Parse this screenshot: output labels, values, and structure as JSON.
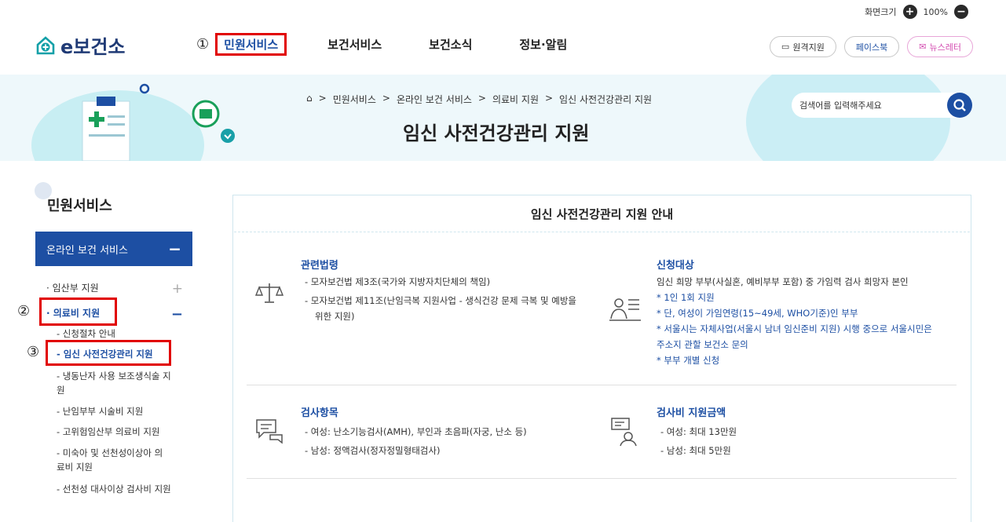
{
  "zoom": {
    "label": "화면크기",
    "value": "100%"
  },
  "logo": {
    "text": "e보건소"
  },
  "gnb": {
    "marker": "①",
    "items": [
      {
        "label": "민원서비스"
      },
      {
        "label": "보건서비스"
      },
      {
        "label": "보건소식"
      },
      {
        "label": "정보·알림"
      }
    ]
  },
  "util": {
    "remote": "원격지원",
    "facebook": "페이스북",
    "newsletter": "뉴스레터"
  },
  "breadcrumb": [
    "민원서비스",
    "온라인 보건 서비스",
    "의료비 지원",
    "임신 사전건강관리 지원"
  ],
  "page_title": "임신 사전건강관리 지원",
  "search": {
    "placeholder": "검색어를 입력해주세요"
  },
  "lnb": {
    "title": "민원서비스",
    "head": "온라인 보건 서비스",
    "items": [
      {
        "label": "· 임산부 지원"
      },
      {
        "label": "· 의료비 지원",
        "marker": "②"
      }
    ],
    "subs": [
      "- 신청절차 안내",
      "- 임신 사전건강관리 지원",
      "- 냉동난자 사용 보조생식술 지원",
      "- 난임부부 시술비 지원",
      "- 고위험임산부 의료비 지원",
      "- 미숙아 및 선천성이상아 의료비 지원",
      "- 선천성 대사이상 검사비 지원"
    ],
    "sub_marker": "③"
  },
  "content": {
    "title": "임신 사전건강관리 지원 안내",
    "law": {
      "title": "관련법령",
      "lines": [
        "- 모자보건법 제3조(국가와 지방자치단체의 책임)",
        "- 모자보건법 제11조(난임극복 지원사업 - 생식건강 문제 극복 및 예방을",
        "위한 지원)"
      ]
    },
    "target": {
      "title": "신청대상",
      "lines": [
        "임신 희망 부부(사실혼, 예비부부 포함) 중 가임력 검사 희망자 본인",
        "* 1인 1회 지원",
        "* 단, 여성이 가임연령(15~49세, WHO기준)인 부부",
        "* 서울시는 자체사업(서울시 남녀 임신준비 지원) 시행 중으로 서울시민은",
        "주소지 관할 보건소 문의",
        "* 부부 개별 신청"
      ]
    },
    "tests": {
      "title": "검사항목",
      "lines": [
        "- 여성: 난소기능검사(AMH), 부인과 초음파(자궁, 난소 등)",
        "- 남성: 정액검사(정자정밀형태검사)"
      ]
    },
    "amount": {
      "title": "검사비 지원금액",
      "lines": [
        "- 여성: 최대 13만원",
        "- 남성: 최대 5만원"
      ]
    }
  },
  "colors": {
    "primary": "#1d4fa3",
    "highlight": "#e10000",
    "banner": "#eef8fb"
  }
}
